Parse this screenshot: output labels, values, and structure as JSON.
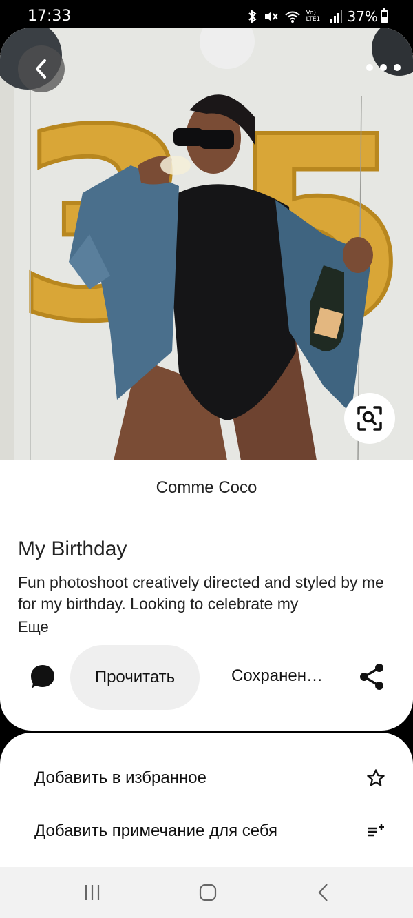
{
  "status_bar": {
    "time": "17:33",
    "network_label": "Vo) LTE1",
    "battery": "37%"
  },
  "pin": {
    "creator": "Comme Coco",
    "title": "My Birthday",
    "description": "Fun photoshoot creatively directed and styled by me for my birthday. Looking to celebrate my",
    "more_label": "Еще",
    "read_label": "Прочитать",
    "saved_label": "Сохранен…",
    "balloon_digits": [
      "3",
      "5"
    ]
  },
  "sheet": {
    "favorite_label": "Добавить в избранное",
    "note_label": "Добавить примечание для себя"
  },
  "colors": {
    "gold": "#d9a637",
    "denim": "#4a6f8c",
    "chip_bg": "#efefef"
  }
}
